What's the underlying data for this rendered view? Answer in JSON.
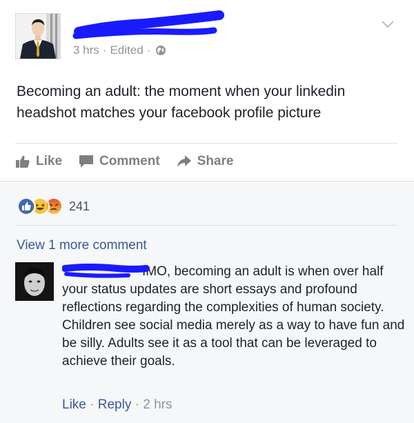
{
  "post": {
    "meta": {
      "time": "3 hrs",
      "separator": "·",
      "edited": "Edited",
      "privacy_icon": "globe-icon"
    },
    "text": "Becoming an adult: the moment when your linkedin headshot matches your facebook profile picture",
    "actions": {
      "like": "Like",
      "comment": "Comment",
      "share": "Share"
    }
  },
  "reactions": {
    "icons": [
      "like-reaction",
      "haha-reaction",
      "angry-reaction"
    ],
    "count": "241"
  },
  "comments": {
    "view_more": "View 1 more comment",
    "items": [
      {
        "paragraph1": "IMO, becoming an adult is when over half your status updates are short essays and profound reflections regarding the complexities of human society.",
        "paragraph2": "Children see social media merely as a way to have fun and be silly. Adults see it as a tool that can be leveraged to achieve their goals.",
        "like": "Like",
        "reply": "Reply",
        "separator": "·",
        "time": "2 hrs"
      }
    ]
  },
  "colors": {
    "link": "#365899",
    "meta": "#90949c",
    "redaction": "#1a1aff",
    "like_blue": "#4267b2",
    "background_feedback": "#f6f7f9"
  }
}
